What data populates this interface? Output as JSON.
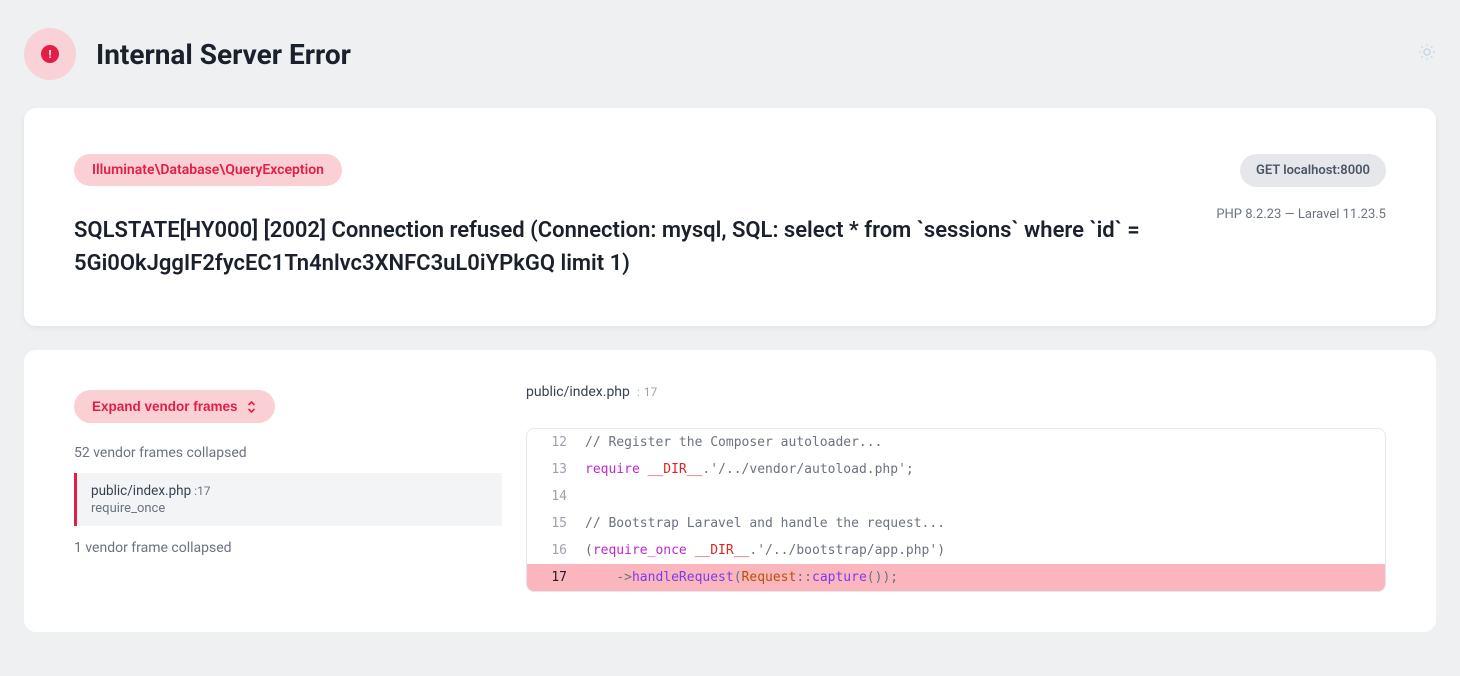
{
  "header": {
    "title": "Internal Server Error",
    "badge_glyph": "!"
  },
  "error": {
    "exception_class": "Illuminate\\Database\\QueryException",
    "message": "SQLSTATE[HY000] [2002] Connection refused (Connection: mysql, SQL: select * from `sessions` where `id` = 5Gi0OkJggIF2fycEC1Tn4nlvc3XNFC3uL0iYPkGQ limit 1)",
    "request": {
      "method": "GET",
      "host": "localhost:8000"
    },
    "php_version": "PHP 8.2.23",
    "framework_version": "Laravel 11.23.5"
  },
  "trace": {
    "expand_label": "Expand vendor frames",
    "collapsed_top": "52 vendor frames collapsed",
    "frame": {
      "file": "public/index.php",
      "line": "17",
      "func": "require_once"
    },
    "collapsed_bottom": "1 vendor frame collapsed"
  },
  "code": {
    "file": "public/index.php",
    "line": "17",
    "lines": {
      "12": {
        "num": "12",
        "text_prefix": "// Register the Composer autoloader..."
      },
      "13": {
        "num": "13",
        "kw": "require",
        "const": "__DIR__",
        "rest": ".'/../vendor/autoload.php';"
      },
      "14": {
        "num": "14"
      },
      "15": {
        "num": "15",
        "text_prefix": "// Bootstrap Laravel and handle the request..."
      },
      "16": {
        "num": "16",
        "open": "(",
        "kw": "require_once",
        "const": "__DIR__",
        "rest": ".'/../bootstrap/app.php')"
      },
      "17": {
        "num": "17",
        "arrow": "->",
        "fn": "handleRequest",
        "open2": "(",
        "cls": "Request",
        "dbl": "::",
        "fn2": "capture",
        "close": "());"
      }
    }
  }
}
